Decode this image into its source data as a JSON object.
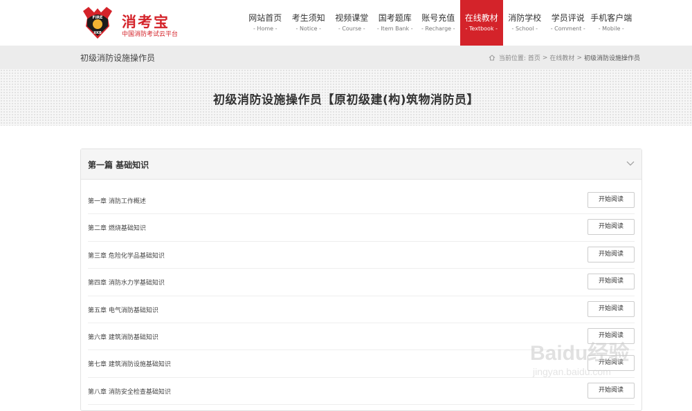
{
  "brand": {
    "name": "消考宝",
    "subtitle": "中国消防考试云平台",
    "badge_top": "FIRE",
    "badge_bottom": "XKB"
  },
  "nav": [
    {
      "cn": "网站首页",
      "en": "- Home -"
    },
    {
      "cn": "考生须知",
      "en": "- Notice -"
    },
    {
      "cn": "视频课堂",
      "en": "- Course -"
    },
    {
      "cn": "国考题库",
      "en": "- Item Bank -"
    },
    {
      "cn": "账号充值",
      "en": "- Recharge -"
    },
    {
      "cn": "在线教材",
      "en": "- Textbook -"
    },
    {
      "cn": "消防学校",
      "en": "- School -"
    },
    {
      "cn": "学员评说",
      "en": "- Comment -"
    },
    {
      "cn": "手机客户端",
      "en": "- Mobile -"
    }
  ],
  "active_nav_index": 5,
  "breadcrumb": {
    "page_title": "初级消防设施操作员",
    "prefix": "当前位置:",
    "home": "首页",
    "sep": ">",
    "section": "在线教材",
    "current": "初级消防设施操作员"
  },
  "banner": {
    "title": "初级消防设施操作员【原初级建(构)筑物消防员】"
  },
  "panel": {
    "title": "第一篇 基础知识",
    "button_label": "开始阅读",
    "chapters": [
      "第一章 消防工作概述",
      "第二章 燃烧基础知识",
      "第三章 危险化学品基础知识",
      "第四章 消防水力学基础知识",
      "第五章 电气消防基础知识",
      "第六章 建筑消防基础知识",
      "第七章 建筑消防设施基础知识",
      "第八章 消防安全检查基础知识"
    ]
  },
  "watermark": {
    "big": "Baidu经验",
    "small": "jingyan.baidu.com"
  },
  "colors": {
    "accent": "#d4232a",
    "crumb_bg": "#ececec"
  }
}
